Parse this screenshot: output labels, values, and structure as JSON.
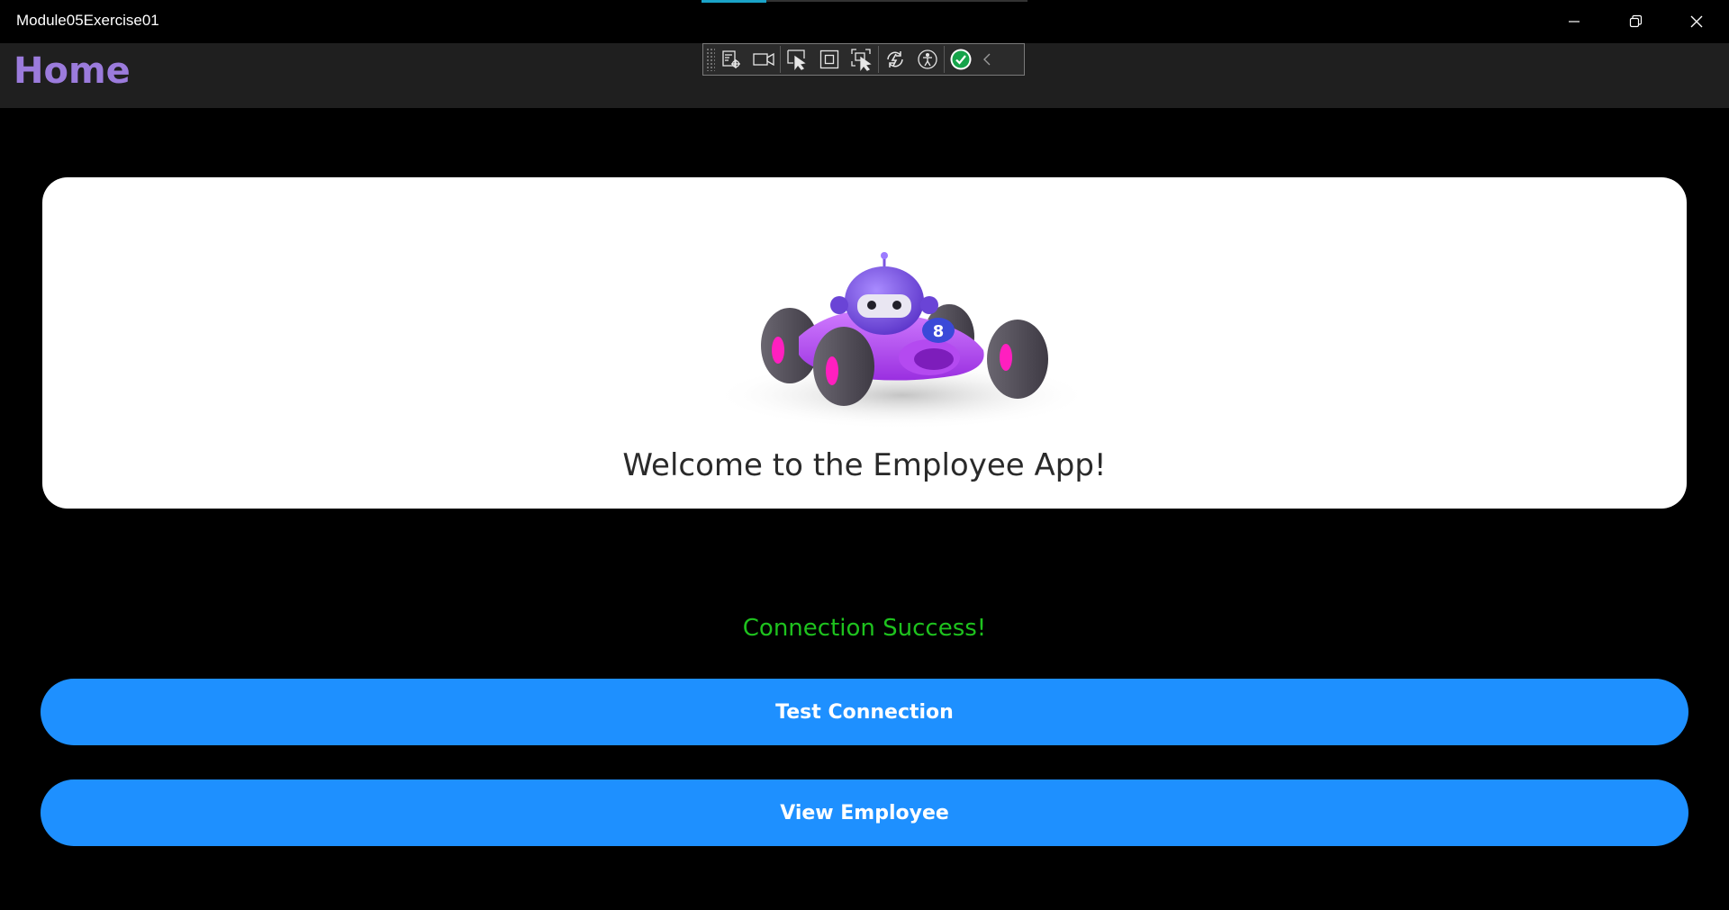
{
  "window": {
    "title": "Module05Exercise01",
    "controls": [
      "minimize-icon",
      "restore-icon",
      "close-icon"
    ]
  },
  "navbar": {
    "title": "Home",
    "title_color": "#9b7bdc"
  },
  "debug_toolbar": {
    "buttons": [
      "live-visual-tree-icon",
      "record-icon",
      "select-element-icon",
      "display-layout-adorners-icon",
      "track-focused-element-icon",
      "hot-reload-icon",
      "accessibility-icon",
      "binding-failures-check-icon",
      "collapse-chevron-icon"
    ]
  },
  "hero": {
    "image": "race-car-bot-illustration",
    "welcome_text": "Welcome to the Employee App!"
  },
  "status": {
    "text": "Connection Success!",
    "color": "#1ec21e"
  },
  "actions": {
    "test_connection_label": "Test Connection",
    "view_employee_label": "View Employee",
    "button_color": "#1e90ff"
  }
}
